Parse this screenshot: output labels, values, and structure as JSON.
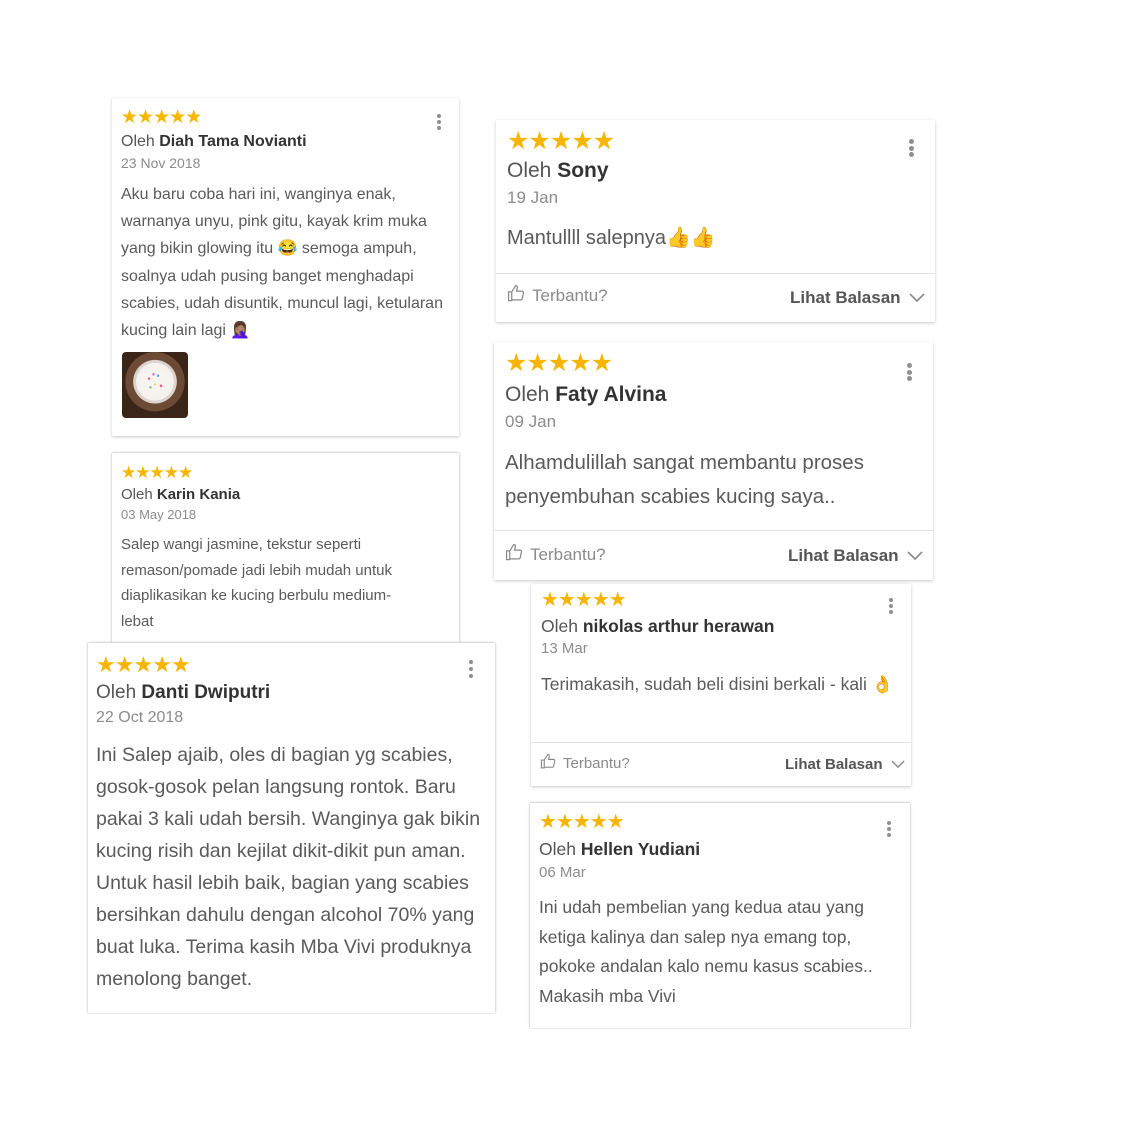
{
  "colors": {
    "star": "#f7b500",
    "muted": "#8c8c8c",
    "text": "#5a5a5a",
    "divider": "#e3e3e3"
  },
  "icons": {
    "star": "star-icon",
    "more": "kebab-menu-icon",
    "thumb": "thumbs-up-icon",
    "chevron": "chevron-down-icon"
  },
  "common": {
    "by_prefix": "Oleh",
    "helpful": "Terbantu?",
    "replies": "Lihat Balasan"
  },
  "reviews": [
    {
      "rating": 5,
      "reviewer": "Diah Tama Novianti",
      "date": "23 Nov 2018",
      "text": "Aku baru coba hari ini, wanginya enak, warnanya unyu, pink gitu, kayak krim muka yang bikin glowing itu 😂 semoga ampuh, soalnya udah pusing banget menghadapi scabies, udah disuntik, muncul lagi, ketularan kucing lain lagi 🤦🏽‍♀️",
      "has_photo": true
    },
    {
      "rating": 5,
      "reviewer": "Karin Kania",
      "date": "03 May 2018",
      "text": "Salep wangi jasmine, tekstur seperti remason/pomade jadi lebih mudah untuk diaplikasikan ke kucing berbulu medium-lebat"
    },
    {
      "rating": 5,
      "reviewer": "Danti Dwiputri",
      "date": "22 Oct 2018",
      "text": "Ini Salep ajaib, oles di bagian yg scabies, gosok-gosok pelan langsung rontok. Baru pakai 3 kali udah bersih. Wanginya gak bikin kucing risih dan kejilat dikit-dikit pun aman. Untuk hasil lebih baik, bagian yang scabies bersihkan dahulu dengan alcohol 70% yang buat luka. Terima kasih Mba Vivi produknya menolong banget."
    },
    {
      "rating": 5,
      "reviewer": "Sony",
      "date": "19 Jan",
      "text": "Mantullll salepnya👍👍"
    },
    {
      "rating": 5,
      "reviewer": "Faty Alvina",
      "date": "09 Jan",
      "text": "Alhamdulillah sangat membantu proses penyembuhan scabies kucing saya.."
    },
    {
      "rating": 5,
      "reviewer": "nikolas arthur herawan",
      "date": "13 Mar",
      "text": "Terimakasih, sudah beli disini berkali - kali 👌"
    },
    {
      "rating": 5,
      "reviewer": "Hellen Yudiani",
      "date": "06 Mar",
      "text": "Ini udah pembelian yang kedua atau yang ketiga kalinya dan salep nya emang top, pokoke andalan kalo nemu kasus scabies.. Makasih mba Vivi"
    }
  ]
}
